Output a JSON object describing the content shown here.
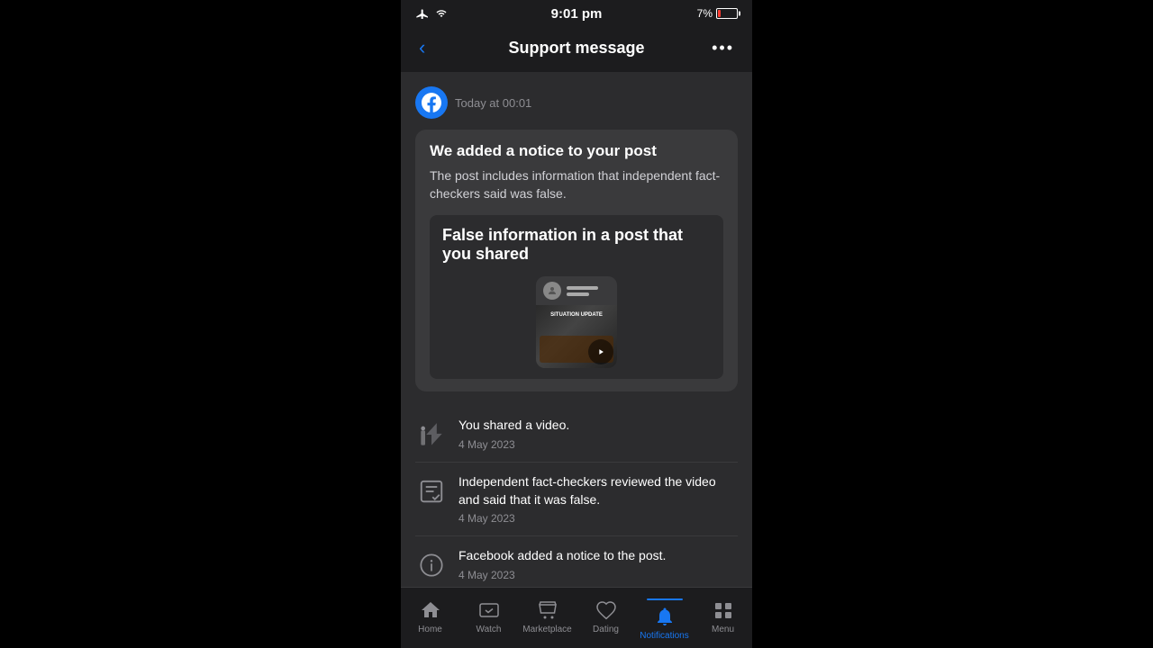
{
  "statusBar": {
    "time": "9:01 pm",
    "battery": "7%"
  },
  "header": {
    "title": "Support message",
    "backLabel": "‹",
    "moreLabel": "•••"
  },
  "message": {
    "timestamp": "Today at 00:01",
    "title": "We added a notice to your post",
    "body": "The post includes information that independent fact-checkers said was false.",
    "falseInfoTitle": "False information in a post that you shared"
  },
  "timeline": [
    {
      "icon": "share-icon",
      "text": "You shared a video.",
      "date": "4 May 2023"
    },
    {
      "icon": "factcheck-icon",
      "text": "Independent fact-checkers reviewed the video and said that it was false.",
      "date": "4 May 2023"
    },
    {
      "icon": "info-icon",
      "text": "Facebook added a notice to the post.",
      "date": "4 May 2023"
    }
  ],
  "nav": [
    {
      "id": "home",
      "label": "Home",
      "active": false
    },
    {
      "id": "watch",
      "label": "Watch",
      "active": false
    },
    {
      "id": "marketplace",
      "label": "Marketplace",
      "active": false
    },
    {
      "id": "dating",
      "label": "Dating",
      "active": false
    },
    {
      "id": "notifications",
      "label": "Notifications",
      "active": true
    },
    {
      "id": "menu",
      "label": "Menu",
      "active": false
    }
  ]
}
